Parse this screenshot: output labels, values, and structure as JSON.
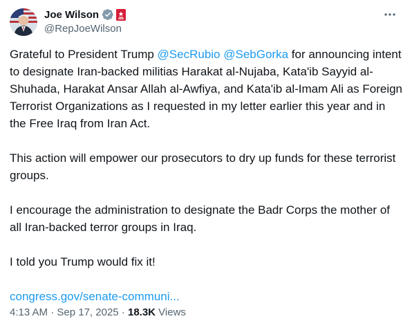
{
  "author": {
    "display_name": "Joe Wilson",
    "handle": "@RepJoeWilson",
    "verified_icon": "gray-check-badge-icon",
    "affiliate_icon": "us-house-badge-icon"
  },
  "tweet": {
    "p1": {
      "t1": "Grateful to President Trump ",
      "m1": "@SecRubio",
      "t2": " ",
      "m2": "@SebGorka",
      "t3": " for announcing intent to designate Iran-backed militias Harakat al-Nujaba, Kata'ib Sayyid al-Shuhada, Harakat Ansar Allah al-Awfiya, and Kata'ib al-Imam Ali as Foreign Terrorist Organizations as I requested in my letter earlier this year and in the Free Iraq from Iran Act."
    },
    "p2": "This action will empower our prosecutors to dry up funds for these terrorist groups.",
    "p3": "I encourage the administration to designate the Badr Corps the mother of all Iran-backed terror groups in Iraq.",
    "p4": "I told you Trump would fix it!",
    "link": "congress.gov/senate-communi..."
  },
  "meta": {
    "time": "4:13 AM",
    "sep1": " · ",
    "date": "Sep 17, 2025",
    "sep2": " · ",
    "views_count": "18.3K",
    "views_label": " Views"
  },
  "colors": {
    "accent": "#1d9bf0",
    "text": "#0f1419",
    "secondary": "#536471",
    "badge_gray": "#829aab",
    "badge_red": "#d6203b"
  }
}
